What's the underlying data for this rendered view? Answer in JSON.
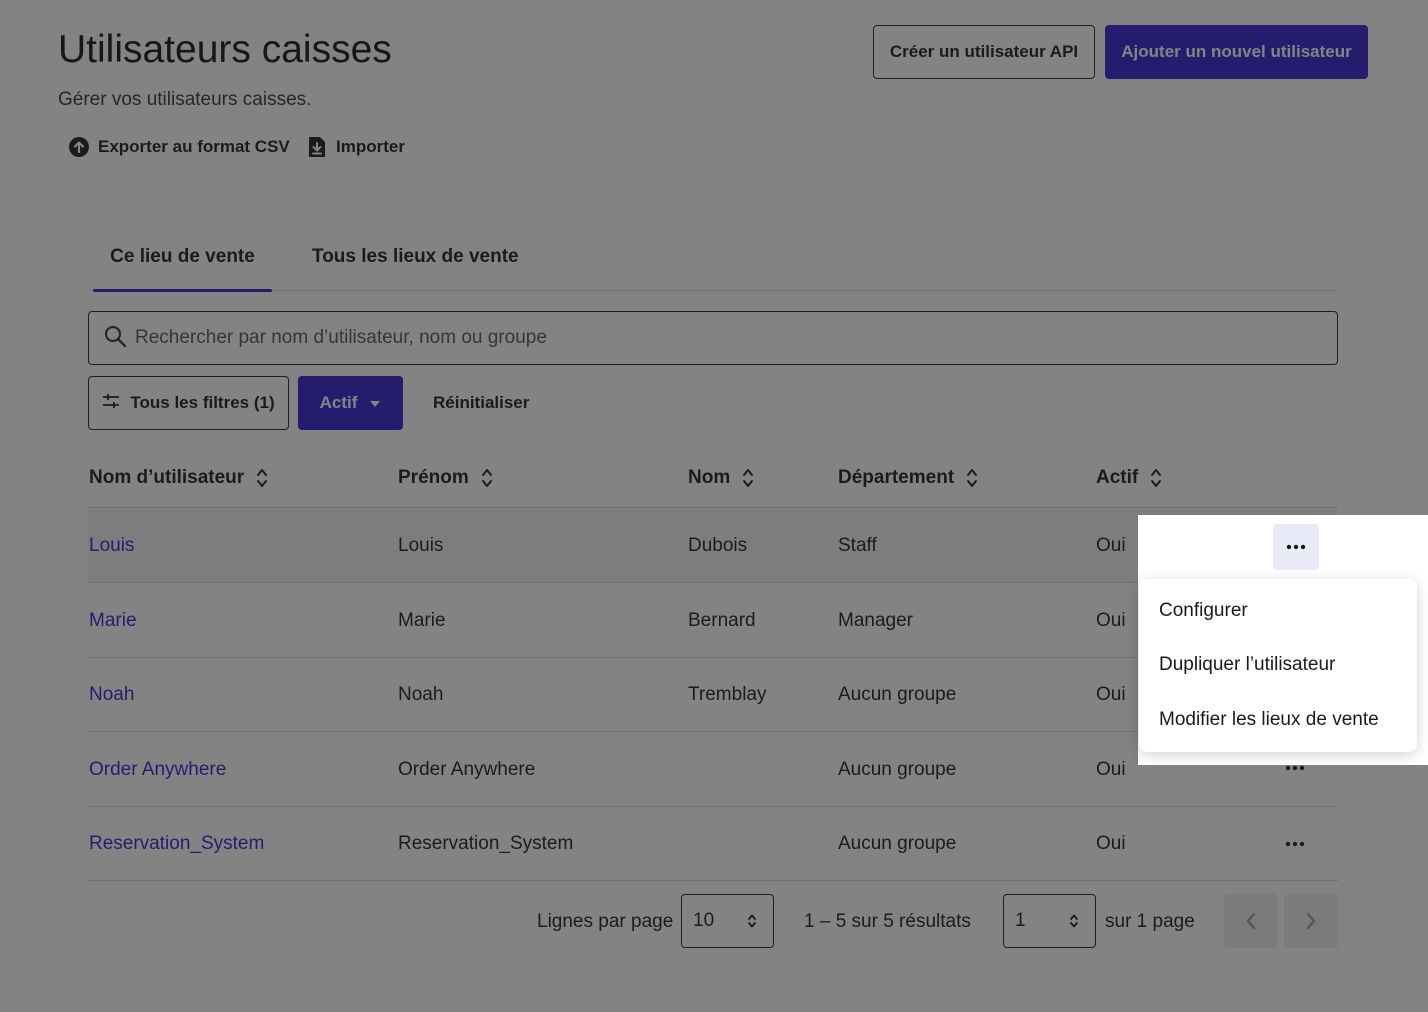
{
  "header": {
    "title": "Utilisateurs caisses",
    "subtitle": "Gérer vos utilisateurs caisses.",
    "create_api_user_label": "Créer un utilisateur API",
    "add_user_label": "Ajouter un nouvel utilisateur"
  },
  "actions": {
    "export_label": "Exporter au format CSV",
    "import_label": "Importer"
  },
  "tabs": [
    {
      "label": "Ce lieu de vente",
      "active": true
    },
    {
      "label": "Tous les lieux de vente",
      "active": false
    }
  ],
  "search": {
    "placeholder": "Rechercher par nom d’utilisateur, nom ou groupe"
  },
  "filters": {
    "all_filters_label": "Tous les filtres (1)",
    "active_filter_label": "Actif",
    "reset_label": "Réinitialiser"
  },
  "table": {
    "columns": [
      "Nom d’utilisateur",
      "Prénom",
      "Nom",
      "Département",
      "Actif"
    ],
    "rows": [
      {
        "username": "Louis",
        "first_name": "Louis",
        "last_name": "Dubois",
        "department": "Staff",
        "active": "Oui"
      },
      {
        "username": "Marie",
        "first_name": "Marie",
        "last_name": "Bernard",
        "department": "Manager",
        "active": "Oui"
      },
      {
        "username": "Noah",
        "first_name": "Noah",
        "last_name": "Tremblay",
        "department": "Aucun groupe",
        "active": "Oui"
      },
      {
        "username": "Order Anywhere",
        "first_name": "Order Anywhere",
        "last_name": "",
        "department": "Aucun groupe",
        "active": "Oui"
      },
      {
        "username": "Reservation_System",
        "first_name": "Reservation_System",
        "last_name": "",
        "department": "Aucun groupe",
        "active": "Oui"
      }
    ]
  },
  "pagination": {
    "rows_per_page_label": "Lignes par page",
    "rows_per_page_value": "10",
    "results_text": "1 – 5 sur 5 résultats",
    "page_value": "1",
    "page_total_text": "sur 1 page"
  },
  "context_menu": {
    "items": [
      "Configurer",
      "Dupliquer l’utilisateur",
      "Modifier les lieux de vente"
    ]
  },
  "colors": {
    "accent": "#2f1cd0",
    "overlay": "rgba(30,30,30,0.55)"
  }
}
